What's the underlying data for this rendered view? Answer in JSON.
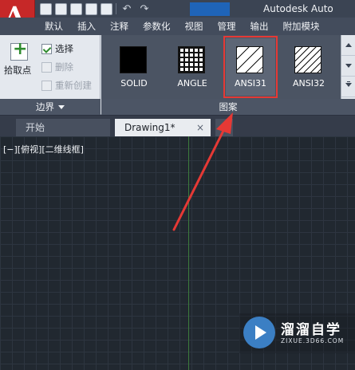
{
  "app": {
    "title": "Autodesk Auto",
    "logo_letter": "A"
  },
  "quick_access": {
    "icons": [
      "new-file-icon",
      "open-file-icon",
      "save-icon",
      "save-as-icon",
      "print-icon",
      "undo-icon",
      "redo-icon"
    ]
  },
  "ribbon_tabs": [
    "默认",
    "插入",
    "注释",
    "参数化",
    "视图",
    "管理",
    "输出",
    "附加模块"
  ],
  "boundary_panel": {
    "pick_points_label": "拾取点",
    "select_label": "选择",
    "remove_label": "删除",
    "recreate_label": "重新创建",
    "title": "边界"
  },
  "pattern_panel": {
    "title": "图案",
    "patterns": [
      {
        "label": "SOLID",
        "type": "solid",
        "selected": false
      },
      {
        "label": "ANGLE",
        "type": "grid",
        "selected": false
      },
      {
        "label": "ANSI31",
        "type": "diag-sparse",
        "selected": true
      },
      {
        "label": "ANSI32",
        "type": "diag-dense",
        "selected": false
      }
    ]
  },
  "file_tabs": {
    "start_label": "开始",
    "active_label": "Drawing1*",
    "close_glyph": "×",
    "plus_glyph": "+"
  },
  "viewport": {
    "label": "[−][俯视][二维线框]"
  },
  "watermark": {
    "name": "溜溜自学",
    "url": "ZIXUE.3D66.COM"
  },
  "colors": {
    "accent_red": "#e53935",
    "app_button": "#c62828",
    "canvas_bg": "#212830"
  }
}
